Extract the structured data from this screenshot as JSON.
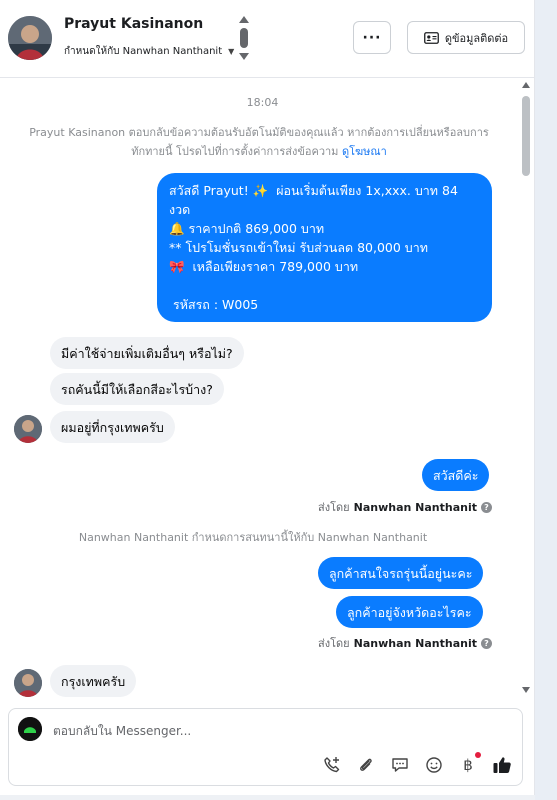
{
  "header": {
    "name": "Prayut Kasinanon",
    "assigned": "กำหนดให้กับ Nanwhan Nanthanit",
    "more_label": "···",
    "contact_label": "ดูข้อมูลติดต่อ"
  },
  "chat": {
    "time": "18:04",
    "system_message": "Prayut Kasinanon ตอบกลับข้อความต้อนรับอัตโนมัติของคุณแล้ว หากต้องการเปลี่ยนหรือลบการทักทายนี้ โปรดไปที่การตั้งค่าการส่งข้อความ",
    "system_link": "ดูโฆษณา",
    "promo_message": "สวัสดี Prayut! ✨  ผ่อนเริ่มต้นเพียง 1x,xxx. บาท 84 งวด\n🔔 ราคาปกติ 869,000 บาท\n** โปรโมชั่นรถเข้าใหม่ รับส่วนลด 80,000 บาท\n🎀  เหลือเพียงราคา 789,000 บาท\n\n รหัสรถ : W005",
    "customer_msgs": [
      "มีค่าใช้จ่ายเพิ่มเติมอื่นๆ หรือไม่?",
      "รถคันนี้มีให้เลือกสีอะไรบ้าง?",
      "ผมอยู่ที่กรุงเทพครับ"
    ],
    "reply_1": "สวัสดีค่ะ",
    "sent_by_prefix": "ส่งโดย",
    "sent_by_name": "Nanwhan Nanthanit",
    "assignment_note": "Nanwhan Nanthanit กำหนดการสนทนานี้ให้กับ Nanwhan Nanthanit",
    "reply_2": "ลูกค้าสนใจรถรุ่นนี้อยู่นะคะ",
    "reply_3": "ลูกค้าอยู่จังหวัดอะไรคะ",
    "customer_last": "กรุงเทพครับ"
  },
  "composer": {
    "placeholder": "ตอบกลับใน Messenger...",
    "baht_icon": "฿"
  },
  "colors": {
    "outgoing": "#0a7cff",
    "incoming": "#f0f2f5",
    "link": "#1877f2"
  }
}
